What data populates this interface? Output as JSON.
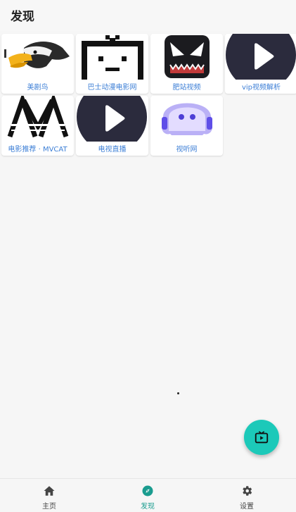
{
  "header": {
    "title": "发现"
  },
  "sites": [
    {
      "label": "美剧鸟",
      "icon": "eagle-logo"
    },
    {
      "label": "巴士动漫电影网",
      "icon": "tv-robot-logo"
    },
    {
      "label": "肥站视频",
      "icon": "venom-logo"
    },
    {
      "label": "vip视频解析",
      "icon": "play-logo"
    },
    {
      "label": "电影推荐 · MVCAT",
      "icon": "mvcat-logo"
    },
    {
      "label": "电视直播",
      "icon": "play-logo"
    },
    {
      "label": "视听网",
      "icon": "ghost-logo"
    }
  ],
  "fab": {
    "icon": "tv-play-icon"
  },
  "bottom_nav": [
    {
      "label": "主页",
      "icon": "home-icon",
      "active": false
    },
    {
      "label": "发现",
      "icon": "compass-icon",
      "active": true
    },
    {
      "label": "设置",
      "icon": "gear-icon",
      "active": false
    }
  ],
  "colors": {
    "accent": "#1cc9b9",
    "link": "#3d7fd6",
    "nav_active": "#1a9c8f"
  }
}
